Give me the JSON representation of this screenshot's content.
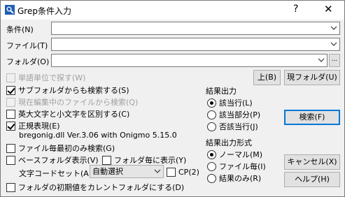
{
  "window": {
    "title": "Grep条件入力",
    "help_glyph": "?",
    "close_glyph": "✕"
  },
  "fields": {
    "condition_label": "条件(N)",
    "condition_value": "",
    "file_label": "ファイル(T)",
    "file_value": "",
    "folder_label": "フォルダ(O)",
    "folder_value": "",
    "browse_label": "..."
  },
  "buttons": {
    "up": "上(B)",
    "current_folder": "現フォルダ(U)",
    "search": "検索(F)",
    "cancel": "キャンセル(X)",
    "help": "ヘルプ(H)"
  },
  "options": {
    "word_unit": {
      "label": "単語単位で探す(W)",
      "checked": false,
      "enabled": false
    },
    "subfolders": {
      "label": "サブフォルダからも検索する(S)",
      "checked": true,
      "enabled": true
    },
    "current_file": {
      "label": "現在編集中のファイルから検索(Q)",
      "checked": false,
      "enabled": false
    },
    "case_sensitive": {
      "label": "英大文字と小文字を区別する(C)",
      "checked": false,
      "enabled": true
    },
    "regex": {
      "label": "正規表現(E)",
      "checked": true,
      "enabled": true
    },
    "regex_info": "bregonig.dll Ver.3.06 with Onigmo 5.15.0",
    "first_only": {
      "label": "ファイル毎最初のみ検索(G)",
      "checked": false,
      "enabled": true
    },
    "base_folder": {
      "label": "ベースフォルダ表示(V)",
      "checked": false,
      "enabled": true
    },
    "per_folder": {
      "label": "フォルダ毎に表示(Y)",
      "checked": false,
      "enabled": true
    },
    "charset_label": "文字コードセット(A)",
    "charset_value": "自動選択",
    "cp": {
      "label": "CP(2)",
      "checked": false,
      "enabled": true
    },
    "default_folder": {
      "label": "フォルダの初期値をカレントフォルダにする(D)",
      "checked": false,
      "enabled": true
    }
  },
  "result_output": {
    "title": "結果出力",
    "items": [
      {
        "label": "該当行(L)",
        "checked": true
      },
      {
        "label": "該当部分(P)",
        "checked": false
      },
      {
        "label": "否該当行(J)",
        "checked": false
      }
    ]
  },
  "result_format": {
    "title": "結果出力形式",
    "items": [
      {
        "label": "ノーマル(M)",
        "checked": true
      },
      {
        "label": "ファイル毎(I)",
        "checked": false
      },
      {
        "label": "結果のみ(R)",
        "checked": false
      }
    ]
  },
  "icons": {
    "app": "magnifier-icon",
    "dropdown": "chevron-down-icon"
  },
  "colors": {
    "accent": "#0078d7",
    "disabled_text": "#a0a0a0"
  }
}
